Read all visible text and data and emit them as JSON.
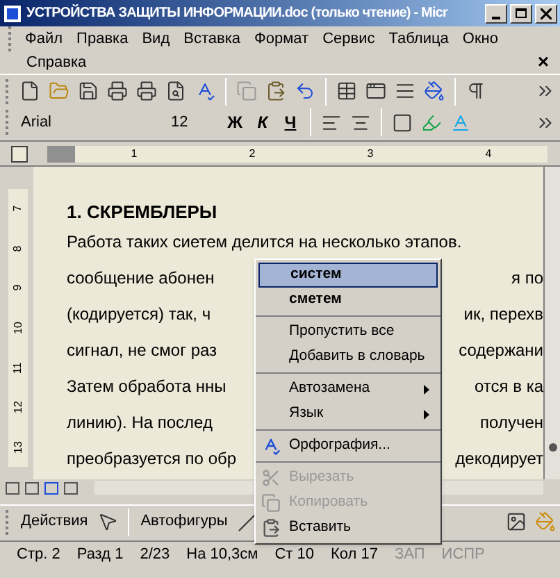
{
  "window": {
    "title": "УСТРОЙСТВА ЗАЩИТЫ ИНФОРМАЦИИ.doc (только чтение) - Micr"
  },
  "menu_bar": {
    "items": [
      "Файл",
      "Правка",
      "Вид",
      "Вставка",
      "Формат",
      "Сервис",
      "Таблица",
      "Окно",
      "Справка"
    ],
    "close": "×"
  },
  "formatting": {
    "font": "Arial",
    "size": "12",
    "bold": "Ж",
    "italic": "К",
    "underline": "Ч"
  },
  "ruler": {
    "marks": [
      "1",
      "2",
      "3",
      "4"
    ],
    "vertical_marks": [
      "7",
      "8",
      "9",
      "10",
      "11",
      "12",
      "13"
    ]
  },
  "document": {
    "heading": "1. СКРЕМБЛЕРЫ",
    "lines": [
      {
        "left": "Работа таких сиетем делится на несколько этапов."
      },
      {
        "left": "сообщение абонен",
        "right": "я по"
      },
      {
        "left": "(кодируется) так, ч",
        "right": "ик, перехв"
      },
      {
        "left": "сигнал, не смог раз",
        "right": "содержани"
      },
      {
        "left": "Затем обработа нны",
        "right": "отся в ка"
      },
      {
        "left": "линию). На послед",
        "right": "получен"
      },
      {
        "left": "преобразуется по обр",
        "right": "декодирует"
      }
    ]
  },
  "context_menu": {
    "groups": [
      [
        {
          "label": "систем",
          "kind": "suggestion",
          "selected": true,
          "disabled": false,
          "submenu": false
        },
        {
          "label": "сметем",
          "kind": "suggestion",
          "selected": false,
          "disabled": false,
          "submenu": false
        }
      ],
      [
        {
          "label": "Пропустить все",
          "kind": "command",
          "selected": false,
          "disabled": false,
          "submenu": false
        },
        {
          "label": "Добавить в словарь",
          "kind": "command",
          "selected": false,
          "disabled": false,
          "submenu": false
        }
      ],
      [
        {
          "label": "Автозамена",
          "kind": "command",
          "selected": false,
          "disabled": false,
          "submenu": true
        },
        {
          "label": "Язык",
          "kind": "command",
          "selected": false,
          "disabled": false,
          "submenu": true
        }
      ],
      [
        {
          "label": "Орфография...",
          "kind": "command",
          "selected": false,
          "disabled": false,
          "submenu": false
        }
      ],
      [
        {
          "label": "Вырезать",
          "kind": "command",
          "selected": false,
          "disabled": true,
          "submenu": false
        },
        {
          "label": "Копировать",
          "kind": "command",
          "selected": false,
          "disabled": true,
          "submenu": false
        },
        {
          "label": "Вставить",
          "kind": "command",
          "selected": false,
          "disabled": false,
          "submenu": false
        }
      ]
    ]
  },
  "drawing_toolbar": {
    "actions": "Действия",
    "autoshapes": "Автофигуры"
  },
  "status_bar": [
    {
      "text": "Стр. 2",
      "active": true
    },
    {
      "text": "Разд 1",
      "active": true
    },
    {
      "text": "2/23",
      "active": true
    },
    {
      "text": "На 10,3см",
      "active": true
    },
    {
      "text": "Ст 10",
      "active": true
    },
    {
      "text": "Кол 17",
      "active": true
    },
    {
      "text": "ЗАП",
      "active": false
    },
    {
      "text": "ИСПР",
      "active": false
    }
  ]
}
